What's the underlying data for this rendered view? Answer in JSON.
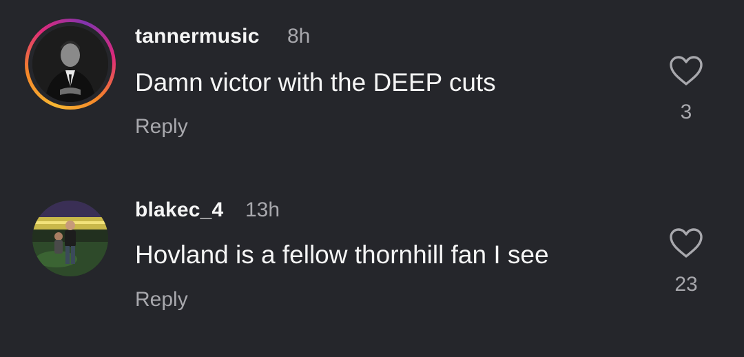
{
  "comments": [
    {
      "username": "tannermusic",
      "time": "8h",
      "text": "Damn victor with the DEEP cuts",
      "reply_label": "Reply",
      "likes": "3",
      "has_story_ring": true
    },
    {
      "username": "blakec_4",
      "time": "13h",
      "text": "Hovland is a fellow thornhill fan I see",
      "reply_label": "Reply",
      "likes": "23",
      "has_story_ring": false
    }
  ],
  "icons": {
    "like": "heart-outline-icon"
  },
  "colors": {
    "background": "#25262b",
    "primary_text": "#f5f5f5",
    "secondary_text": "#a8a8ad",
    "story_ring_start": "#f7b733",
    "story_ring_end": "#dd2a7b"
  }
}
